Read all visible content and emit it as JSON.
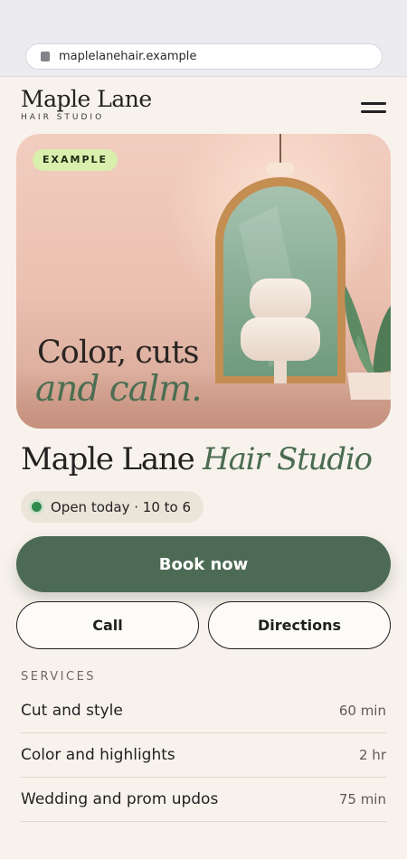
{
  "browser": {
    "url": "maplelanehair.example"
  },
  "header": {
    "brand": "Maple Lane",
    "brand_sub": "HAIR STUDIO"
  },
  "hero": {
    "badge": "EXAMPLE",
    "headline_line1": "Color, cuts",
    "headline_line2": "and calm."
  },
  "studio": {
    "title_plain": "Maple Lane",
    "title_italic": "Hair Studio"
  },
  "status": {
    "text": "Open today · 10 to 6",
    "color": "#2f8a4e"
  },
  "actions": {
    "book": "Book now",
    "call": "Call",
    "directions": "Directions"
  },
  "services": {
    "label": "SERVICES",
    "items": [
      {
        "name": "Cut and style",
        "duration": "60 min"
      },
      {
        "name": "Color and highlights",
        "duration": "2 hr"
      },
      {
        "name": "Wedding and prom updos",
        "duration": "75 min"
      }
    ]
  },
  "colors": {
    "accent_green": "#4d6a54",
    "badge_green": "#d9efae",
    "background": "#f7f2ec"
  }
}
